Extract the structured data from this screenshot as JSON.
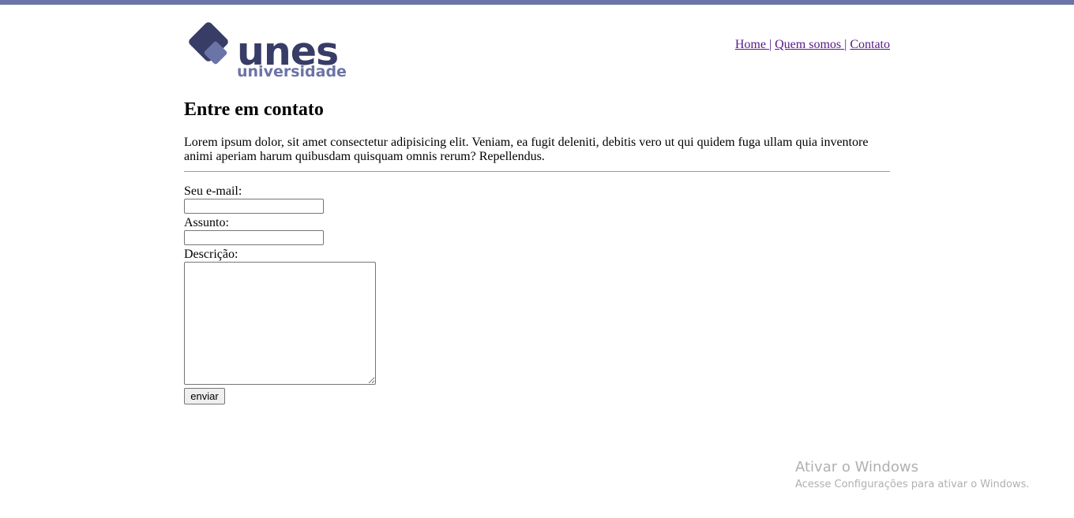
{
  "brand": {
    "name": "unes",
    "subtitle": "universidade",
    "colors": {
      "dark": "#373d66",
      "accent": "#6b74a6"
    }
  },
  "nav": {
    "items": [
      {
        "label": "Home "
      },
      {
        "label": "Quem somos "
      },
      {
        "label": "Contato"
      }
    ],
    "separator": "|"
  },
  "main": {
    "title": "Entre em contato",
    "intro": "Lorem ipsum dolor, sit amet consectetur adipisicing elit. Veniam, ea fugit deleniti, debitis vero ut qui quidem fuga ullam quia inventore animi aperiam harum quibusdam quisquam omnis rerum? Repellendus."
  },
  "form": {
    "email_label": "Seu e-mail:",
    "email_value": "",
    "subject_label": "Assunto:",
    "subject_value": "",
    "description_label": "Descrição:",
    "description_value": "",
    "submit_label": "enviar"
  },
  "watermark": {
    "title": "Ativar o Windows",
    "subtitle": "Acesse Configurações para ativar o Windows."
  }
}
